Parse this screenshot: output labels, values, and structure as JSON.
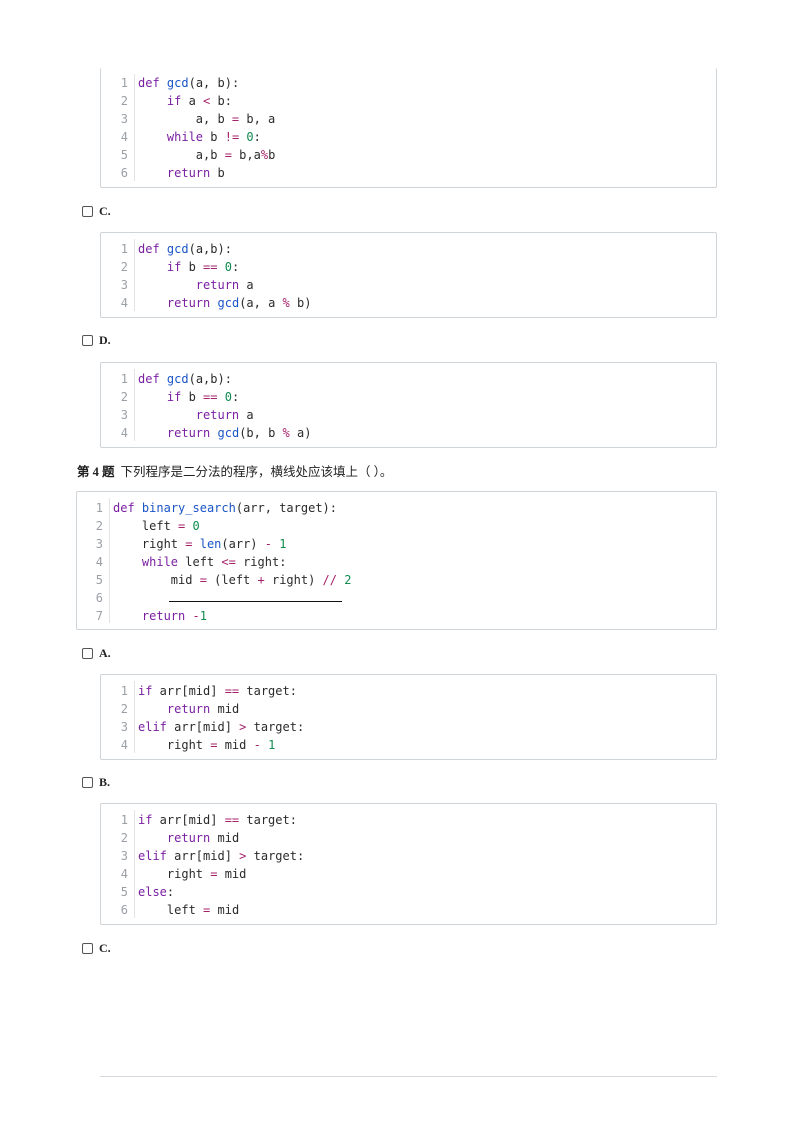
{
  "options": {
    "c1": "C.",
    "d1": "D.",
    "a2": "A.",
    "b2": "B.",
    "c2": "C."
  },
  "question4": {
    "number": "第 4 题",
    "text": "下列程序是二分法的程序，横线处应该填上（ ）。"
  },
  "code_blocks": {
    "b1": [
      {
        "n": "1",
        "t": "def gcd(a, b):"
      },
      {
        "n": "2",
        "t": "    if a < b:"
      },
      {
        "n": "3",
        "t": "        a, b = b, a"
      },
      {
        "n": "4",
        "t": "    while b != 0:"
      },
      {
        "n": "5",
        "t": "        a,b = b,a%b"
      },
      {
        "n": "6",
        "t": "    return b"
      }
    ],
    "c1": [
      {
        "n": "1",
        "t": "def gcd(a,b):"
      },
      {
        "n": "2",
        "t": "    if b == 0:"
      },
      {
        "n": "3",
        "t": "        return a"
      },
      {
        "n": "4",
        "t": "    return gcd(a, a % b)"
      }
    ],
    "d1": [
      {
        "n": "1",
        "t": "def gcd(a,b):"
      },
      {
        "n": "2",
        "t": "    if b == 0:"
      },
      {
        "n": "3",
        "t": "        return a"
      },
      {
        "n": "4",
        "t": "    return gcd(b, b % a)"
      }
    ],
    "q4": [
      {
        "n": "1",
        "t": "def binary_search(arr, target):"
      },
      {
        "n": "2",
        "t": "    left = 0"
      },
      {
        "n": "3",
        "t": "    right = len(arr) - 1"
      },
      {
        "n": "4",
        "t": "    while left <= right:"
      },
      {
        "n": "5",
        "t": "        mid = (left + right) // 2"
      },
      {
        "n": "6",
        "t": ""
      },
      {
        "n": "7",
        "t": "    return -1"
      }
    ],
    "a2": [
      {
        "n": "1",
        "t": "if arr[mid] == target:"
      },
      {
        "n": "2",
        "t": "    return mid"
      },
      {
        "n": "3",
        "t": "elif arr[mid] > target:"
      },
      {
        "n": "4",
        "t": "    right = mid - 1"
      }
    ],
    "b2": [
      {
        "n": "1",
        "t": "if arr[mid] == target:"
      },
      {
        "n": "2",
        "t": "    return mid"
      },
      {
        "n": "3",
        "t": "elif arr[mid] > target:"
      },
      {
        "n": "4",
        "t": "    right = mid"
      },
      {
        "n": "5",
        "t": "else:"
      },
      {
        "n": "6",
        "t": "    left = mid"
      }
    ]
  }
}
